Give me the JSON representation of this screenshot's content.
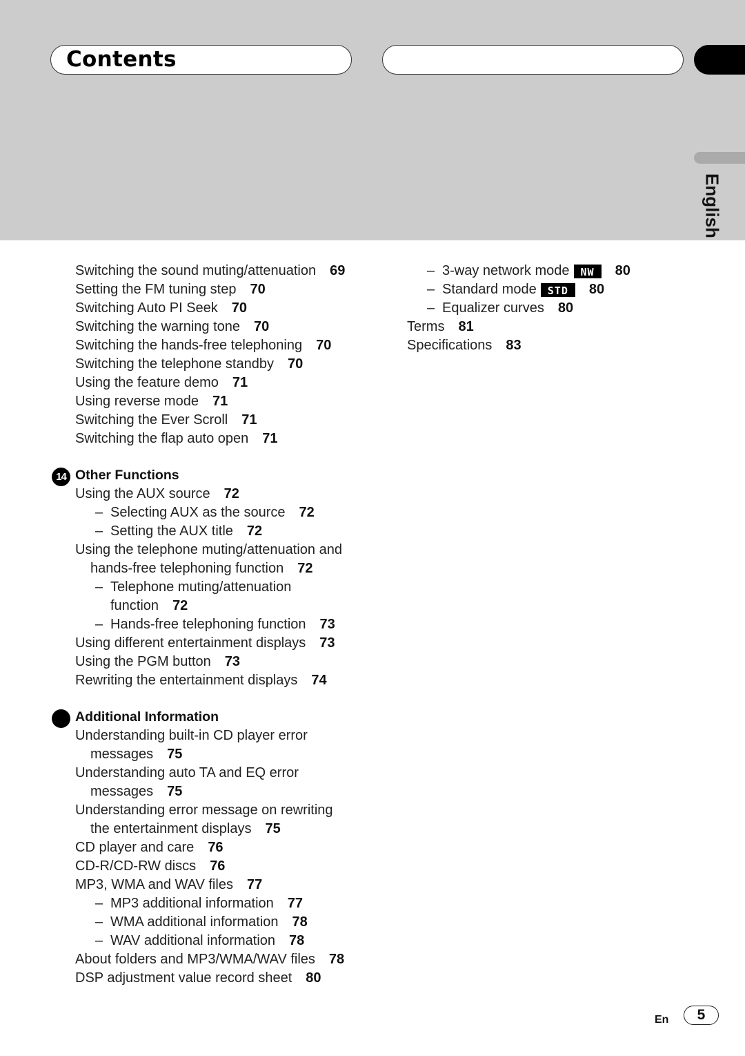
{
  "header": {
    "title": "Contents",
    "language_tab": "English"
  },
  "left_column": {
    "items_top": [
      {
        "text": "Switching the sound muting/attenuation",
        "page": "69"
      },
      {
        "text": "Setting the FM tuning step",
        "page": "70"
      },
      {
        "text": "Switching Auto PI Seek",
        "page": "70"
      },
      {
        "text": "Switching the warning tone",
        "page": "70"
      },
      {
        "text": "Switching the hands-free telephoning",
        "page": "70"
      },
      {
        "text": "Switching the telephone standby",
        "page": "70"
      },
      {
        "text": "Using the feature demo",
        "page": "71"
      },
      {
        "text": "Using reverse mode",
        "page": "71"
      },
      {
        "text": "Switching the Ever Scroll",
        "page": "71"
      },
      {
        "text": "Switching the flap auto open",
        "page": "71"
      }
    ],
    "section14": {
      "number": "14",
      "title": "Other Functions",
      "items": [
        {
          "text": "Using the AUX source",
          "page": "72"
        },
        {
          "text": "Selecting AUX as the source",
          "page": "72"
        },
        {
          "text": "Setting the AUX title",
          "page": "72"
        },
        {
          "text": "Using the telephone muting/attenuation and",
          "page": ""
        },
        {
          "text": "hands-free telephoning function",
          "page": "72"
        },
        {
          "text": "Telephone muting/attenuation",
          "page": ""
        },
        {
          "text": "function",
          "page": "72"
        },
        {
          "text": "Hands-free telephoning function",
          "page": "73"
        },
        {
          "text": "Using different entertainment displays",
          "page": "73"
        },
        {
          "text": "Using the PGM button",
          "page": "73"
        },
        {
          "text": "Rewriting the entertainment displays",
          "page": "74"
        }
      ]
    },
    "section15": {
      "number": "",
      "title": "Additional Information",
      "items": [
        {
          "text": "Understanding built-in CD player error",
          "page": ""
        },
        {
          "text": "messages",
          "page": "75"
        },
        {
          "text": "Understanding auto TA and EQ error",
          "page": ""
        },
        {
          "text": "messages",
          "page": "75"
        },
        {
          "text": "Understanding error message on rewriting",
          "page": ""
        },
        {
          "text": "the entertainment displays",
          "page": "75"
        },
        {
          "text": "CD player and care",
          "page": "76"
        },
        {
          "text": "CD-R/CD-RW discs",
          "page": "76"
        },
        {
          "text": "MP3, WMA and WAV files",
          "page": "77"
        },
        {
          "text": "MP3 additional information",
          "page": "77"
        },
        {
          "text": "WMA additional information",
          "page": "78"
        },
        {
          "text": "WAV additional information",
          "page": "78"
        },
        {
          "text": "About folders and MP3/WMA/WAV files",
          "page": "78"
        },
        {
          "text": "DSP adjustment value record sheet",
          "page": "80"
        }
      ]
    }
  },
  "right_column": {
    "items": [
      {
        "text": "3-way network mode",
        "badge": "NW",
        "page": "80"
      },
      {
        "text": "Standard mode",
        "badge": "STD",
        "page": "80"
      },
      {
        "text": "Equalizer curves",
        "page": "80"
      },
      {
        "text": "Terms",
        "page": "81"
      },
      {
        "text": "Specifications",
        "page": "83"
      }
    ]
  },
  "footer": {
    "language_code": "En",
    "page_number": "5"
  },
  "dash": "–"
}
